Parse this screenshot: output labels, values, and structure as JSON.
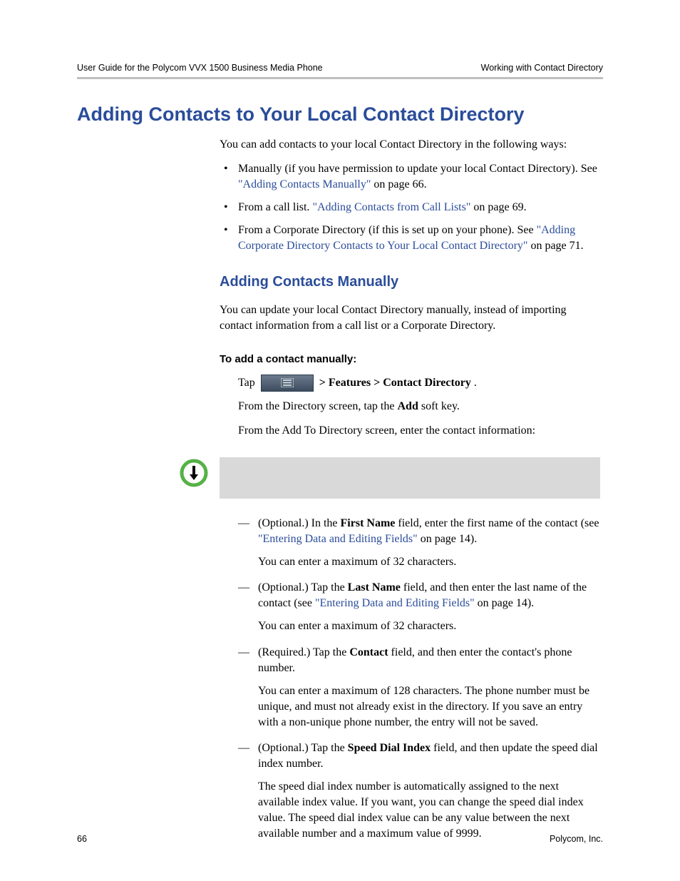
{
  "header": {
    "left": "User Guide for the Polycom VVX 1500 Business Media Phone",
    "right": "Working with Contact Directory"
  },
  "h1": "Adding Contacts to Your Local Contact Directory",
  "intro": "You can add contacts to your local Contact Directory in the following ways:",
  "bullets": {
    "b1_pre": "Manually (if you have permission to update your local Contact Directory). See ",
    "b1_link": "\"Adding Contacts Manually\"",
    "b1_post": " on page 66.",
    "b2_pre": "From a call list. ",
    "b2_link": "\"Adding Contacts from Call Lists\"",
    "b2_post": " on page 69.",
    "b3_pre": "From a Corporate Directory (if this is set up on your phone). See ",
    "b3_link": "\"Adding Corporate Directory Contacts to Your Local Contact Directory\"",
    "b3_post": " on page 71."
  },
  "h2": "Adding Contacts Manually",
  "h2_p": "You can update your local Contact Directory manually, instead of importing contact information from a call list or a Corporate Directory.",
  "h3": "To add a contact manually:",
  "step1": {
    "tap": "Tap",
    "path": " > Features > Contact Directory",
    "dot": "."
  },
  "step2_a": "From the Directory screen, tap the ",
  "step2_b": "Add",
  "step2_c": " soft key.",
  "step3": "From the Add To Directory screen, enter the contact information:",
  "dash": {
    "d1_a": "(Optional.) In the ",
    "d1_b": "First Name",
    "d1_c": " field, enter the first name of the contact (see ",
    "d1_link": "\"Entering Data and Editing Fields\"",
    "d1_d": " on page 14).",
    "d1_sub": "You can enter a maximum of 32 characters.",
    "d2_a": "(Optional.) Tap the ",
    "d2_b": "Last Name",
    "d2_c": " field, and then enter the last name of the contact (see ",
    "d2_link": "\"Entering Data and Editing Fields\"",
    "d2_d": " on page 14).",
    "d2_sub": "You can enter a maximum of 32 characters.",
    "d3_a": "(Required.) Tap the ",
    "d3_b": "Contact",
    "d3_c": " field, and then enter the contact's phone number.",
    "d3_sub": "You can enter a maximum of 128 characters. The phone number must be unique, and must not already exist in the directory. If you save an entry with a non-unique phone number, the entry will not be saved.",
    "d4_a": "(Optional.) Tap the ",
    "d4_b": "Speed Dial Index",
    "d4_c": " field, and then update the speed dial index number.",
    "d4_sub": "The speed dial index number is automatically assigned to the next available index value. If you want, you can change the speed dial index value. The speed dial index value can be any value between the next available number and a maximum value of 9999."
  },
  "footer": {
    "left": "66",
    "right": "Polycom, Inc."
  }
}
